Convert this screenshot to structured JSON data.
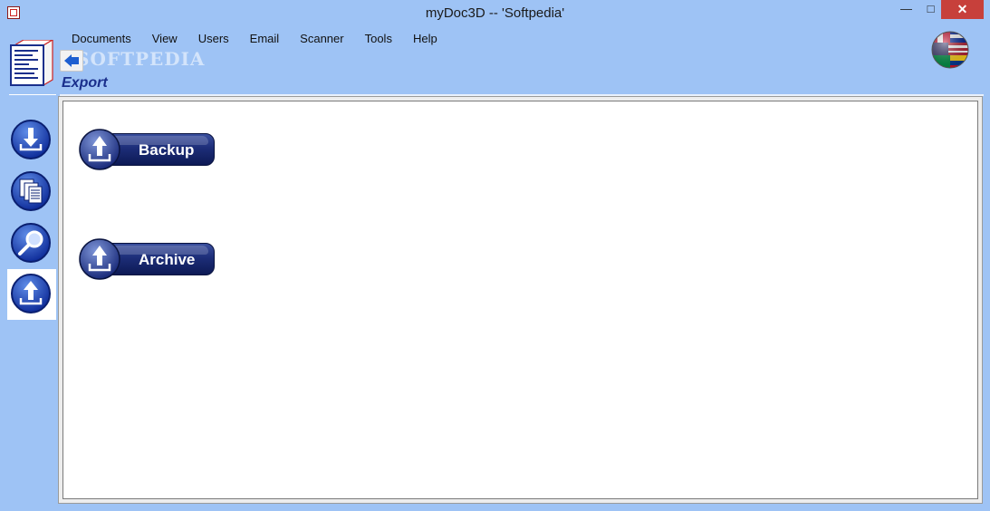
{
  "window": {
    "title": "myDoc3D  --  'Softpedia'",
    "minimize_glyph": "—",
    "maximize_glyph": "□",
    "close_glyph": "✕"
  },
  "menu": {
    "items": [
      {
        "label": "Documents"
      },
      {
        "label": "View"
      },
      {
        "label": "Users"
      },
      {
        "label": "Email"
      },
      {
        "label": "Scanner"
      },
      {
        "label": "Tools"
      },
      {
        "label": "Help"
      }
    ]
  },
  "watermark": "SOFTPEDIA",
  "page": {
    "heading": "Export"
  },
  "sidebar": {
    "items": [
      {
        "name": "import",
        "icon": "download-icon"
      },
      {
        "name": "documents",
        "icon": "documents-icon"
      },
      {
        "name": "search",
        "icon": "magnifier-icon"
      },
      {
        "name": "export",
        "icon": "upload-icon",
        "active": true
      }
    ]
  },
  "actions": {
    "backup_label": "Backup",
    "archive_label": "Archive"
  },
  "colors": {
    "chrome": "#9ec3f5",
    "button_dark": "#1d2d78",
    "heading": "#1a2f8c",
    "close": "#c7403b"
  }
}
